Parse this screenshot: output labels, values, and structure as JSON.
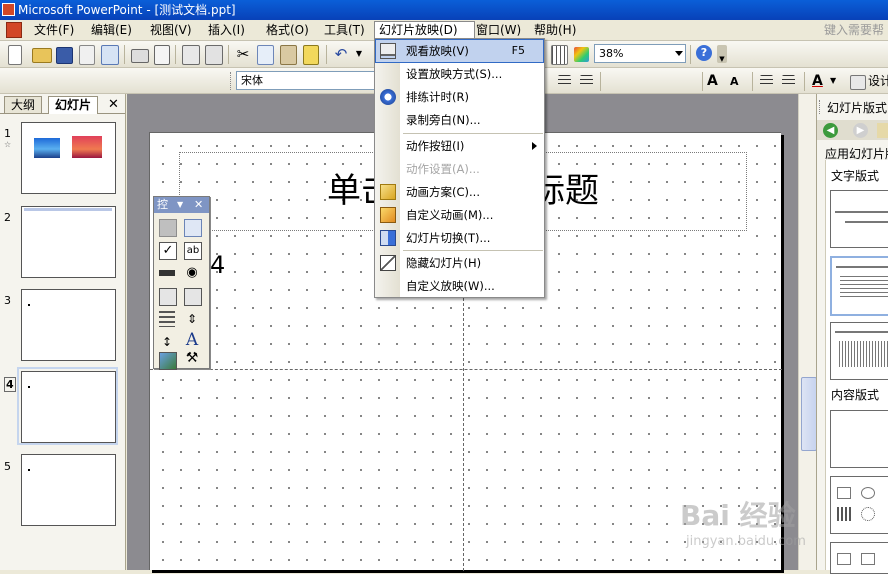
{
  "window": {
    "title": "Microsoft PowerPoint - [测试文档.ppt]"
  },
  "menubar": {
    "items": [
      "文件(F)",
      "编辑(E)",
      "视图(V)",
      "插入(I)",
      "格式(O)",
      "工具(T)",
      "幻灯片放映(D)",
      "窗口(W)",
      "帮助(H)"
    ],
    "help_hint": "键入需要帮"
  },
  "toolbar": {
    "zoom": "38%"
  },
  "format_toolbar": {
    "font": "宋体",
    "design_label": "设计"
  },
  "slide_panel": {
    "tabs": [
      "大纲",
      "幻灯片"
    ],
    "slide_numbers": [
      "1",
      "2",
      "3",
      "4",
      "5"
    ],
    "selected_slide": 4
  },
  "slide": {
    "title_placeholder": "单击此处添加标题",
    "body_text": "4"
  },
  "control_toolbox": {
    "title": "控"
  },
  "task_pane": {
    "title": "幻灯片版式",
    "apply_label": "应用幻灯片版",
    "section_text": "文字版式",
    "section_content": "内容版式"
  },
  "slideshow_menu": {
    "items": [
      {
        "label": "观看放映(V)",
        "shortcut": "F5",
        "icon": "projector-icon",
        "highlighted": true
      },
      {
        "label": "设置放映方式(S)...",
        "icon": ""
      },
      {
        "label": "排练计时(R)",
        "icon": "rehearse-timings-icon"
      },
      {
        "label": "录制旁白(N)...",
        "icon": ""
      },
      {
        "label": "动作按钮(I)",
        "icon": "",
        "submenu": true
      },
      {
        "label": "动作设置(A)...",
        "icon": "",
        "disabled": true
      },
      {
        "label": "动画方案(C)...",
        "icon": "animation-scheme-icon"
      },
      {
        "label": "自定义动画(M)...",
        "icon": "custom-animation-icon"
      },
      {
        "label": "幻灯片切换(T)...",
        "icon": "slide-transition-icon"
      },
      {
        "label": "隐藏幻灯片(H)",
        "icon": "hide-slide-icon"
      },
      {
        "label": "自定义放映(W)...",
        "icon": ""
      }
    ]
  },
  "watermark": {
    "brand": "Bai 经验",
    "url": "jingyan.baidu.com"
  },
  "colors": {
    "titlebar": "#0a5fd8",
    "menu_highlight": "#c1d2ee",
    "workarea": "#8c8b90",
    "accent_red": "#d24726"
  }
}
